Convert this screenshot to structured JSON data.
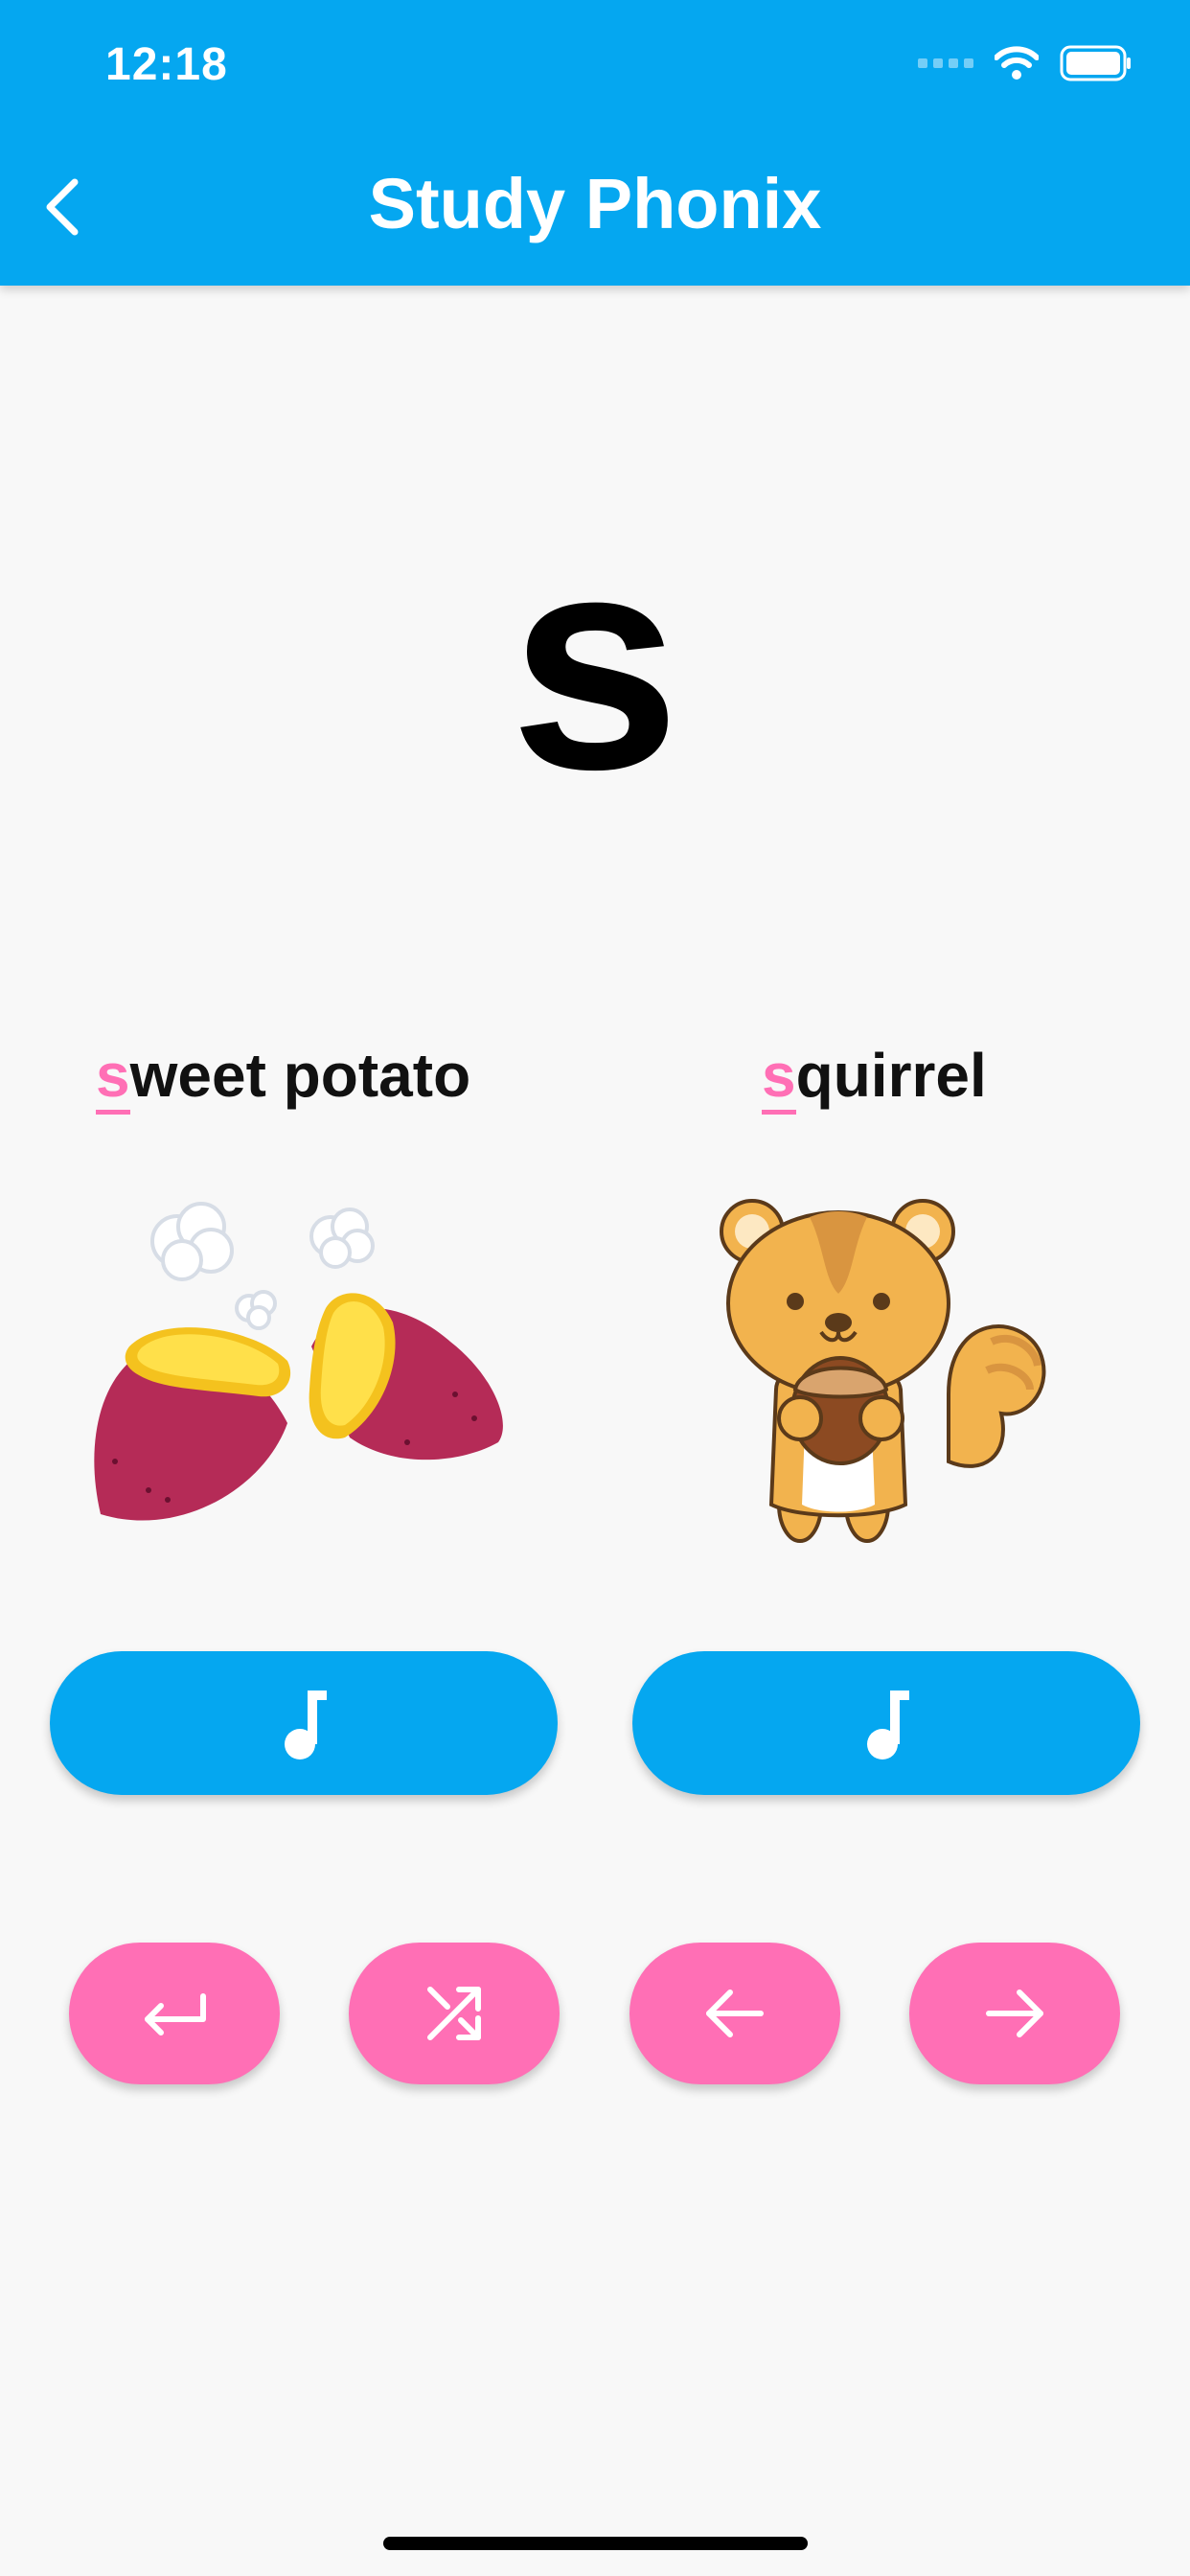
{
  "status": {
    "time": "12:18"
  },
  "header": {
    "title": "Study Phonix"
  },
  "letter": "s",
  "words": {
    "left": {
      "highlight": "s",
      "rest": "weet potato",
      "image_icon": "sweet-potato-illustration"
    },
    "right": {
      "highlight": "s",
      "rest": "quirrel",
      "image_icon": "squirrel-illustration"
    }
  },
  "audio_buttons": {
    "icon": "music-note-icon"
  },
  "nav_buttons": [
    {
      "icon": "return-icon"
    },
    {
      "icon": "shuffle-icon"
    },
    {
      "icon": "arrow-left-icon"
    },
    {
      "icon": "arrow-right-icon"
    }
  ],
  "colors": {
    "primary": "#05a7f0",
    "accent": "#ff6fb5",
    "background": "#f8f8f8"
  }
}
